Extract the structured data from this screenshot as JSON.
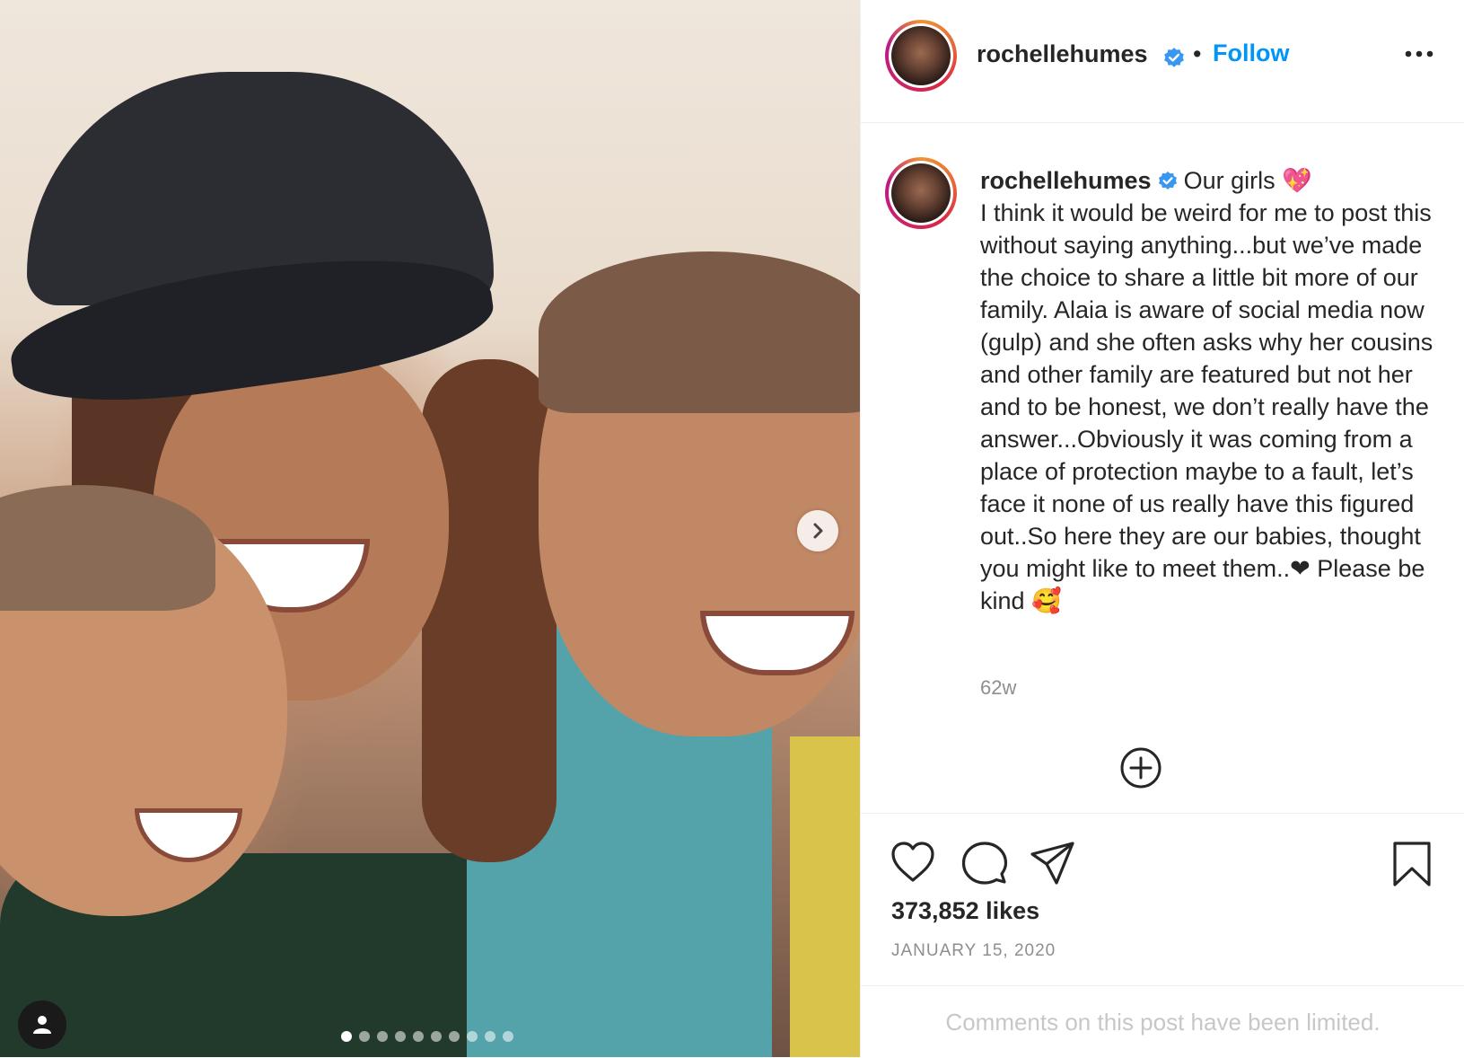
{
  "post": {
    "username": "rochellehumes",
    "follow_separator": "•",
    "follow_label": "Follow",
    "caption": {
      "first_line": "Our girls 💖",
      "text": "I think it would be weird for me to post this without saying anything...but we’ve made the choice to share a little bit more of our family. Alaia is aware of social media now (gulp) and she often asks why her cousins and other family are featured but not her and to be honest, we don’t really have the answer...Obviously it was coming from a place of protection maybe to a fault, let’s face it none of us really have this figured out..So here they are our babies, thought you might like to meet them..❤ Please be kind 🥰"
    },
    "relative_time": "62w",
    "likes": "373,852 likes",
    "date": "JANUARY 15, 2020",
    "comments_notice": "Comments on this post have been limited."
  },
  "carousel": {
    "slide_count": 10,
    "active_index": 0
  },
  "colors": {
    "link_blue": "#0095f6",
    "verified_blue": "#3897f0",
    "muted_gray": "#8e8e8e"
  },
  "icons": {
    "verified": "verified-badge-icon",
    "more": "more-options-icon",
    "next": "chevron-right-icon",
    "tag": "user-tag-icon",
    "load_more": "plus-circle-icon",
    "like": "heart-icon",
    "comment": "comment-bubble-icon",
    "share": "paper-plane-icon",
    "save": "bookmark-icon"
  }
}
